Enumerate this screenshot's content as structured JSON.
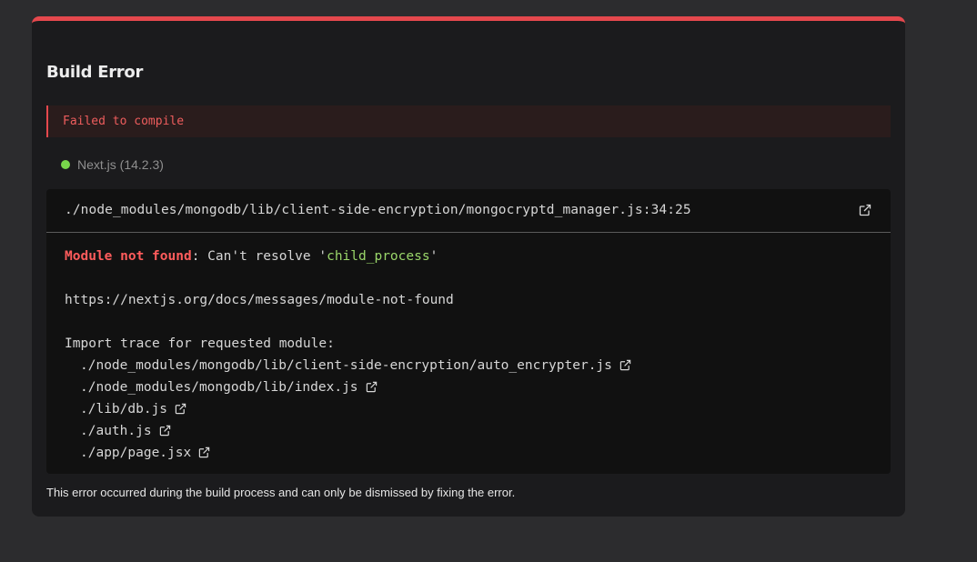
{
  "dialog": {
    "title": "Build Error",
    "banner": "Failed to compile",
    "version": "Next.js (14.2.3)",
    "status_color": "#78d64b",
    "accent_color": "#e5484d",
    "file_path": "./node_modules/mongodb/lib/client-side-encryption/mongocryptd_manager.js:34:25",
    "error": {
      "label": "Module not found",
      "sep": ": Can't resolve '",
      "module": "child_process",
      "end": "'"
    },
    "docs_url": "https://nextjs.org/docs/messages/module-not-found",
    "trace_title": "Import trace for requested module:",
    "trace": [
      "./node_modules/mongodb/lib/client-side-encryption/auto_encrypter.js",
      "./node_modules/mongodb/lib/index.js",
      "./lib/db.js",
      "./auth.js",
      "./app/page.jsx"
    ],
    "footer": "This error occurred during the build process and can only be dismissed by fixing the error."
  }
}
